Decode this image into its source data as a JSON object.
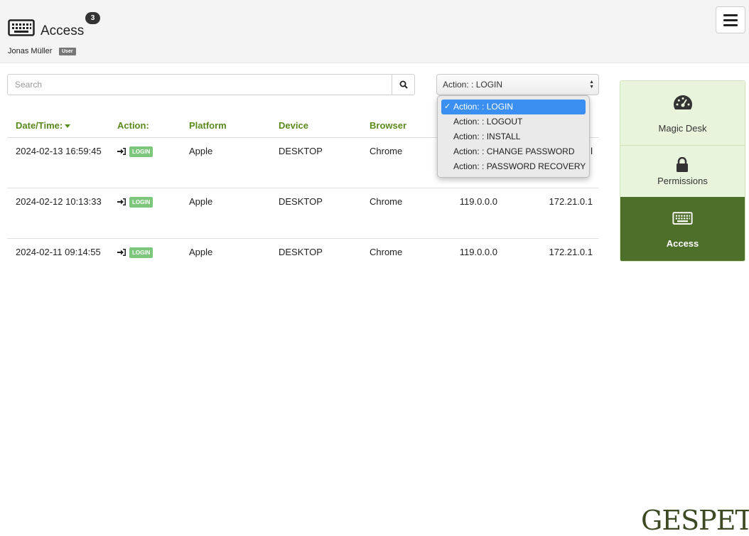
{
  "header": {
    "title": "Access",
    "count_badge": "3",
    "user_name": "Jonas Müller",
    "role_badge": "User",
    "icon": "keyboard-icon",
    "menu_icon": "hamburger-icon"
  },
  "search": {
    "placeholder": "Search",
    "value": "",
    "button_icon": "search-icon"
  },
  "filter": {
    "selected": "Action: :  LOGIN",
    "options": [
      {
        "label": "Action: :  LOGIN",
        "selected": true
      },
      {
        "label": "Action: :  LOGOUT",
        "selected": false
      },
      {
        "label": "Action: :  INSTALL",
        "selected": false
      },
      {
        "label": "Action: :  CHANGE PASSWORD",
        "selected": false
      },
      {
        "label": "Action: :  PASSWORD RECOVERY",
        "selected": false
      }
    ],
    "check_mark": "✓"
  },
  "table": {
    "columns": [
      "Date/Time:",
      "Action:",
      "Platform",
      "Device",
      "Browser"
    ],
    "sort_icon": "caret-down-icon",
    "rows": [
      {
        "datetime": "2024-02-13 16:59:45",
        "action": "LOGIN",
        "platform": "Apple",
        "device": "DESKTOP",
        "browser": "Chrome",
        "version": "",
        "ip": "l"
      },
      {
        "datetime": "2024-02-12 10:13:33",
        "action": "LOGIN",
        "platform": "Apple",
        "device": "DESKTOP",
        "browser": "Chrome",
        "version": "119.0.0.0",
        "ip": "172.21.0.1"
      },
      {
        "datetime": "2024-02-11 09:14:55",
        "action": "LOGIN",
        "platform": "Apple",
        "device": "DESKTOP",
        "browser": "Chrome",
        "version": "119.0.0.0",
        "ip": "172.21.0.1"
      }
    ]
  },
  "sidenav": {
    "items": [
      {
        "label": "Magic Desk",
        "icon": "dashboard-gauge-icon",
        "active": false
      },
      {
        "label": "Permissions",
        "icon": "lock-icon",
        "active": false
      },
      {
        "label": "Access",
        "icon": "keyboard-icon",
        "active": true
      }
    ]
  },
  "footer": {
    "logo_text": "GESPET"
  },
  "colors": {
    "accent_green": "#5a8a1e",
    "active_nav": "#4d6f2a",
    "nav_bg": "#e9f4dc",
    "badge_green": "#7cc77c",
    "dropdown_highlight": "#3a8ff0"
  }
}
